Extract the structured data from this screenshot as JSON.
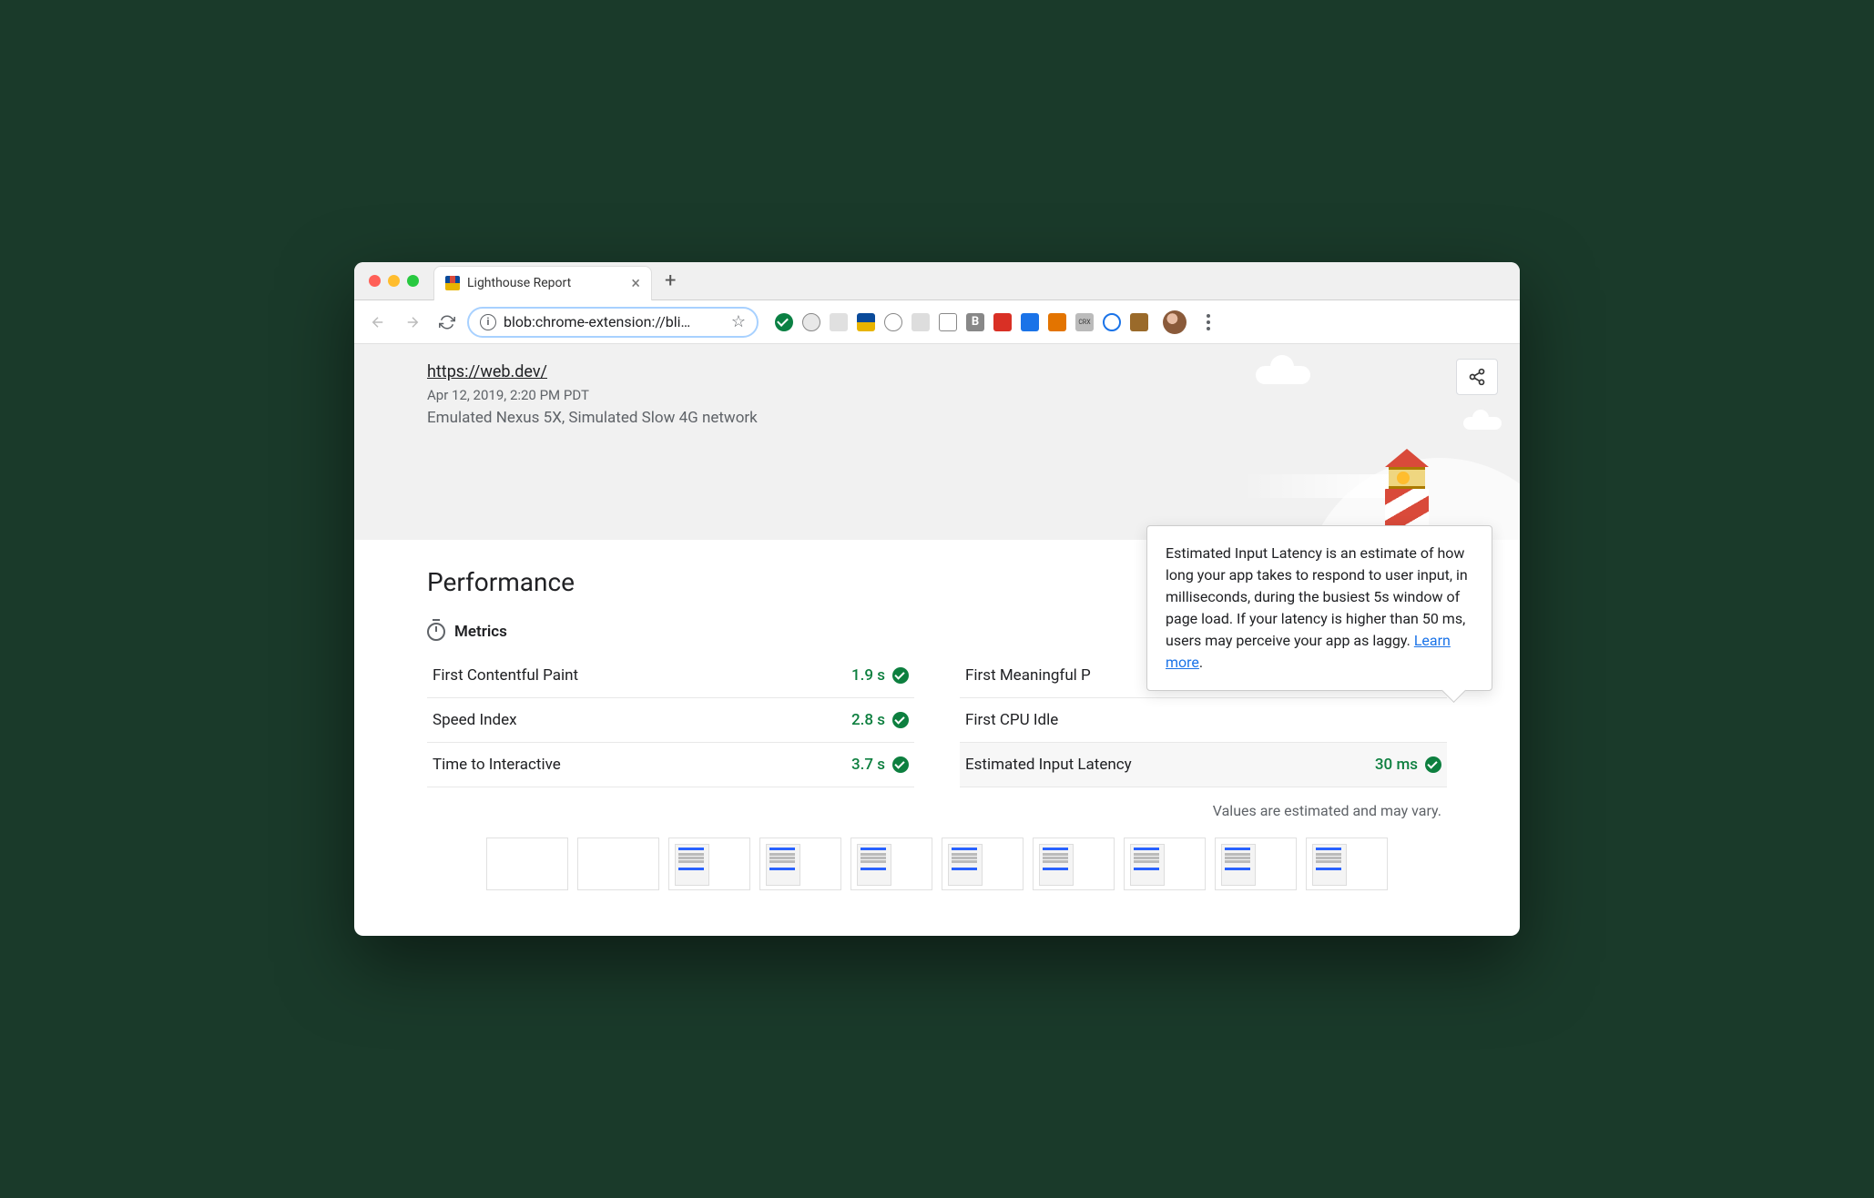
{
  "browser": {
    "tab_title": "Lighthouse Report",
    "url": "blob:chrome-extension://bli…"
  },
  "report": {
    "url": "https://web.dev/",
    "timestamp": "Apr 12, 2019, 2:20 PM PDT",
    "environment": "Emulated Nexus 5X, Simulated Slow 4G network"
  },
  "section": {
    "title": "Performance",
    "metrics_label": "Metrics",
    "footnote": "Values are estimated and may vary."
  },
  "metrics_left": [
    {
      "name": "First Contentful Paint",
      "value": "1.9 s"
    },
    {
      "name": "Speed Index",
      "value": "2.8 s"
    },
    {
      "name": "Time to Interactive",
      "value": "3.7 s"
    }
  ],
  "metrics_right": [
    {
      "name": "First Meaningful P",
      "value": ""
    },
    {
      "name": "First CPU Idle",
      "value": ""
    },
    {
      "name": "Estimated Input Latency",
      "value": "30 ms"
    }
  ],
  "tooltip": {
    "text": "Estimated Input Latency is an estimate of how long your app takes to respond to user input, in milliseconds, during the busiest 5s window of page load. If your latency is higher than 50 ms, users may perceive your app as laggy. ",
    "link": "Learn more"
  }
}
